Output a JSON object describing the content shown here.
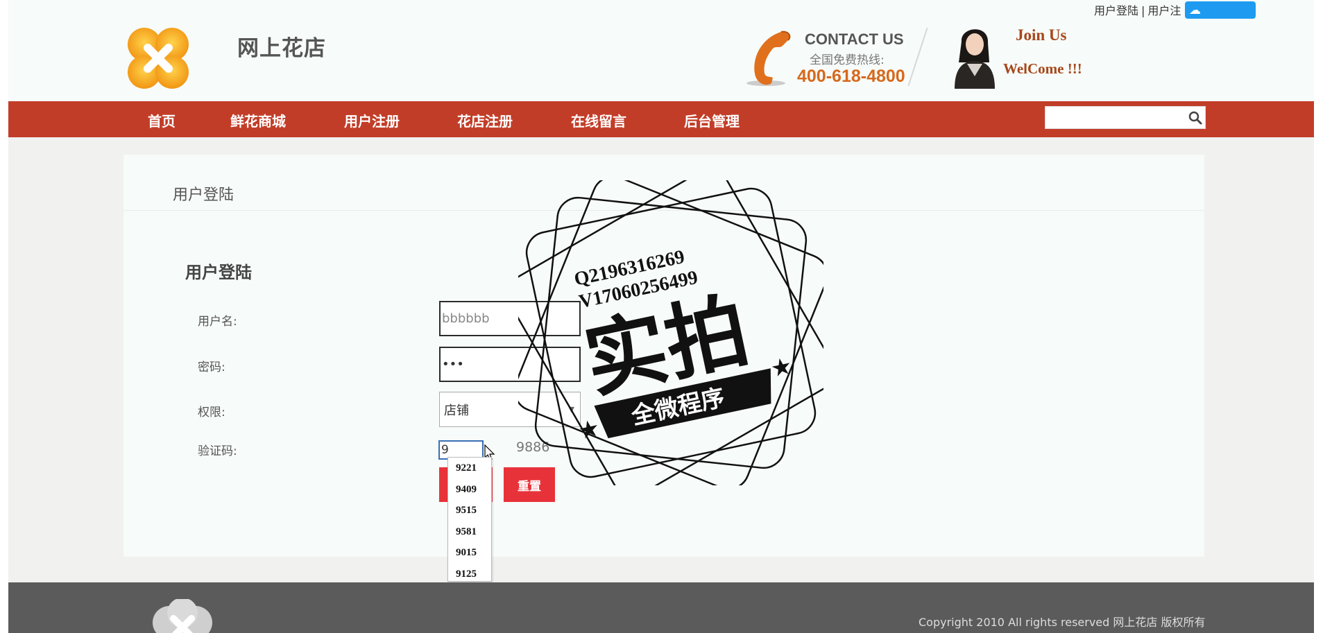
{
  "header": {
    "top_links": {
      "login": "用户登陆",
      "separator": "|",
      "register_partial": "用户注"
    },
    "cloud_badge": {
      "icon": "cloud-icon",
      "text": ""
    },
    "site_name": "网上花店",
    "contact_title": "CONTACT US",
    "hotline_label": "全国免费热线:",
    "hotline": "400-618-4800",
    "join": "Join Us",
    "welcome": "WelCome !!!"
  },
  "nav": {
    "items": [
      "首页",
      "鲜花商城",
      "用户注册",
      "花店注册",
      "在线留言",
      "后台管理"
    ],
    "search_placeholder": "",
    "search_icon": "search-icon"
  },
  "panel": {
    "title": "用户登陆",
    "form_title": "用户登陆",
    "labels": {
      "username": "用户名:",
      "password": "密码:",
      "role": "权限:",
      "captcha": "验证码:"
    },
    "username_value": "bbbbbb",
    "password_value": "•••",
    "role_value": "店铺",
    "captcha_value": "9",
    "captcha_code": "9886",
    "reset_button": "重置",
    "autocomplete": [
      "9221",
      "9409",
      "9515",
      "9581",
      "9015",
      "9125"
    ]
  },
  "watermark": {
    "line1": "Q2196316269",
    "line2": "V17060256499",
    "big": "实拍",
    "banner": "全微程序"
  },
  "footer": {
    "copyright": "Copyright 2010 All rights reserved 网上花店 版权所有"
  },
  "colors": {
    "nav_bg": "#c23d28",
    "button_red": "#e8323a",
    "hotline_orange": "#d6691c",
    "footer_bg": "#5b5b5b"
  }
}
